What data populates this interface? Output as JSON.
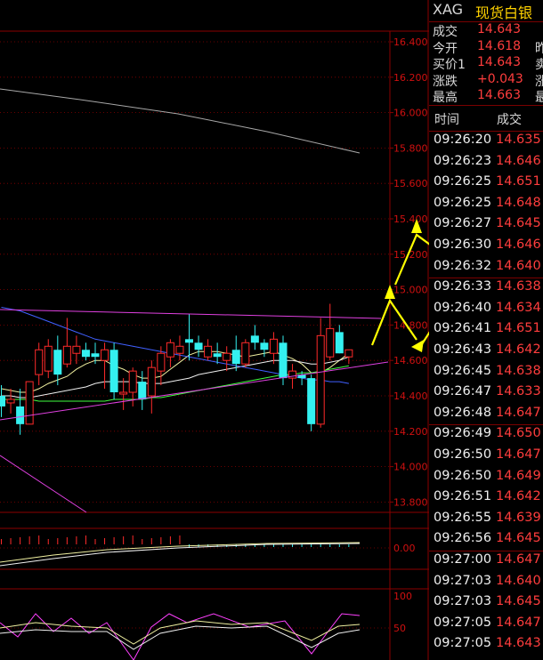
{
  "header": {
    "symbol": "XAG",
    "name": "现货白银"
  },
  "quote": [
    {
      "label": "成交",
      "value": "14.643",
      "cut": ""
    },
    {
      "label": "今开",
      "value": "14.618",
      "cut": "昨"
    },
    {
      "label": "买价1",
      "value": "14.643",
      "cut": "卖"
    },
    {
      "label": "涨跌",
      "value": "+0.043",
      "cut": "涨"
    },
    {
      "label": "最高",
      "value": "14.663",
      "cut": "最"
    }
  ],
  "ticks_header": {
    "time": "时间",
    "price": "成交"
  },
  "ticks": [
    {
      "time": "09:26:20",
      "price": "14.635"
    },
    {
      "time": "09:26:23",
      "price": "14.646"
    },
    {
      "time": "09:26:25",
      "price": "14.651"
    },
    {
      "time": "09:26:25",
      "price": "14.648"
    },
    {
      "time": "09:26:27",
      "price": "14.645"
    },
    {
      "time": "09:26:30",
      "price": "14.646"
    },
    {
      "time": "09:26:32",
      "price": "14.640"
    },
    {
      "time": "09:26:33",
      "price": "14.638"
    },
    {
      "time": "09:26:40",
      "price": "14.634"
    },
    {
      "time": "09:26:41",
      "price": "14.651"
    },
    {
      "time": "09:26:43",
      "price": "14.642"
    },
    {
      "time": "09:26:45",
      "price": "14.638"
    },
    {
      "time": "09:26:47",
      "price": "14.633"
    },
    {
      "time": "09:26:48",
      "price": "14.647"
    },
    {
      "time": "09:26:49",
      "price": "14.650"
    },
    {
      "time": "09:26:50",
      "price": "14.647"
    },
    {
      "time": "09:26:50",
      "price": "14.649"
    },
    {
      "time": "09:26:51",
      "price": "14.642"
    },
    {
      "time": "09:26:55",
      "price": "14.639"
    },
    {
      "time": "09:26:56",
      "price": "14.645"
    },
    {
      "time": "09:27:00",
      "price": "14.647"
    },
    {
      "time": "09:27:03",
      "price": "14.640"
    },
    {
      "time": "09:27:03",
      "price": "14.645"
    },
    {
      "time": "09:27:05",
      "price": "14.647"
    },
    {
      "time": "09:27:05",
      "price": "14.643"
    }
  ],
  "chart_data": {
    "type": "candlestick",
    "price_axis_labels": [
      "16.400",
      "16.200",
      "16.000",
      "15.800",
      "15.600",
      "15.400",
      "15.200",
      "15.000",
      "14.800",
      "14.600",
      "14.400",
      "14.200",
      "14.000",
      "13.800"
    ],
    "macd_axis_labels": [
      "0.00"
    ],
    "kdj_axis_labels": [
      "100",
      "50"
    ],
    "ylim": [
      13.7,
      16.5
    ],
    "candles": [
      [
        14.4,
        14.46,
        14.28,
        14.34
      ],
      [
        14.36,
        14.44,
        14.3,
        14.38
      ],
      [
        14.34,
        14.44,
        14.18,
        14.24
      ],
      [
        14.24,
        14.48,
        14.24,
        14.48
      ],
      [
        14.52,
        14.7,
        14.46,
        14.66
      ],
      [
        14.54,
        14.72,
        14.5,
        14.68
      ],
      [
        14.66,
        14.74,
        14.46,
        14.52
      ],
      [
        14.58,
        14.84,
        14.56,
        14.68
      ],
      [
        14.64,
        14.74,
        14.58,
        14.68
      ],
      [
        14.66,
        14.7,
        14.6,
        14.62
      ],
      [
        14.64,
        14.7,
        14.58,
        14.62
      ],
      [
        14.6,
        14.7,
        14.44,
        14.66
      ],
      [
        14.66,
        14.7,
        14.38,
        14.42
      ],
      [
        14.42,
        14.5,
        14.32,
        14.42
      ],
      [
        14.42,
        14.56,
        14.34,
        14.54
      ],
      [
        14.48,
        14.54,
        14.32,
        14.38
      ],
      [
        14.4,
        14.6,
        14.3,
        14.56
      ],
      [
        14.54,
        14.68,
        14.46,
        14.64
      ],
      [
        14.62,
        14.72,
        14.56,
        14.7
      ],
      [
        14.64,
        14.74,
        14.6,
        14.68
      ],
      [
        14.72,
        14.86,
        14.6,
        14.7
      ],
      [
        14.7,
        14.74,
        14.62,
        14.66
      ],
      [
        14.62,
        14.72,
        14.6,
        14.68
      ],
      [
        14.64,
        14.7,
        14.58,
        14.62
      ],
      [
        14.6,
        14.68,
        14.54,
        14.64
      ],
      [
        14.66,
        14.74,
        14.54,
        14.58
      ],
      [
        14.58,
        14.72,
        14.56,
        14.7
      ],
      [
        14.74,
        14.8,
        14.66,
        14.7
      ],
      [
        14.7,
        14.72,
        14.62,
        14.66
      ],
      [
        14.64,
        14.76,
        14.58,
        14.72
      ],
      [
        14.7,
        14.74,
        14.46,
        14.5
      ],
      [
        14.5,
        14.58,
        14.44,
        14.54
      ],
      [
        14.52,
        14.54,
        14.46,
        14.5
      ],
      [
        14.5,
        14.52,
        14.2,
        14.24
      ],
      [
        14.24,
        14.84,
        14.22,
        14.74
      ],
      [
        14.62,
        14.92,
        14.6,
        14.78
      ],
      [
        14.76,
        14.8,
        14.64,
        14.64
      ],
      [
        14.62,
        14.66,
        14.58,
        14.66
      ]
    ],
    "ma1": [
      14.44,
      14.43,
      14.42,
      14.42,
      14.44,
      14.47,
      14.49,
      14.51,
      14.55,
      14.58,
      14.6,
      14.6,
      14.57,
      14.55,
      14.52,
      14.5,
      14.5,
      14.51,
      14.55,
      14.59,
      14.63,
      14.65,
      14.65,
      14.65,
      14.64,
      14.63,
      14.62,
      14.63,
      14.64,
      14.65,
      14.63,
      14.61,
      14.58,
      14.53,
      14.53,
      14.56,
      14.6,
      14.64
    ],
    "ma2": [
      14.4,
      14.4,
      14.39,
      14.39,
      14.4,
      14.41,
      14.42,
      14.43,
      14.44,
      14.45,
      14.47,
      14.48,
      14.48,
      14.48,
      14.48,
      14.47,
      14.47,
      14.47,
      14.48,
      14.49,
      14.5,
      14.52,
      14.53,
      14.54,
      14.55,
      14.56,
      14.57,
      14.58,
      14.59,
      14.6,
      14.6,
      14.6,
      14.59,
      14.58,
      14.58,
      14.59,
      14.6,
      14.62
    ],
    "ma3": [
      14.38,
      14.38,
      14.38,
      14.38,
      14.37,
      14.37,
      14.37,
      14.37,
      14.37,
      14.37,
      14.37,
      14.37,
      14.38,
      14.38,
      14.38,
      14.38,
      14.39,
      14.39,
      14.4,
      14.41,
      14.42,
      14.43,
      14.44,
      14.45,
      14.46,
      14.47,
      14.48,
      14.49,
      14.5,
      14.51,
      14.52,
      14.52,
      14.53,
      14.53,
      14.54,
      14.55,
      14.56,
      14.57
    ],
    "ma4": [
      14.9,
      14.89,
      14.88,
      14.86,
      14.84,
      14.82,
      14.8,
      14.78,
      14.76,
      14.74,
      14.72,
      14.71,
      14.7,
      14.69,
      14.68,
      14.67,
      14.66,
      14.65,
      14.64,
      14.63,
      14.62,
      14.61,
      14.6,
      14.59,
      14.58,
      14.57,
      14.56,
      14.55,
      14.54,
      14.53,
      14.52,
      14.51,
      14.5,
      14.49,
      14.49,
      14.48,
      14.48,
      14.47
    ]
  },
  "colors": {
    "up": "#ff2a2a",
    "down": "#34f0f0",
    "grid": "#8b0000",
    "axis_text": "#d01010",
    "arrow": "#ffff00",
    "trend": "#e040e0"
  }
}
